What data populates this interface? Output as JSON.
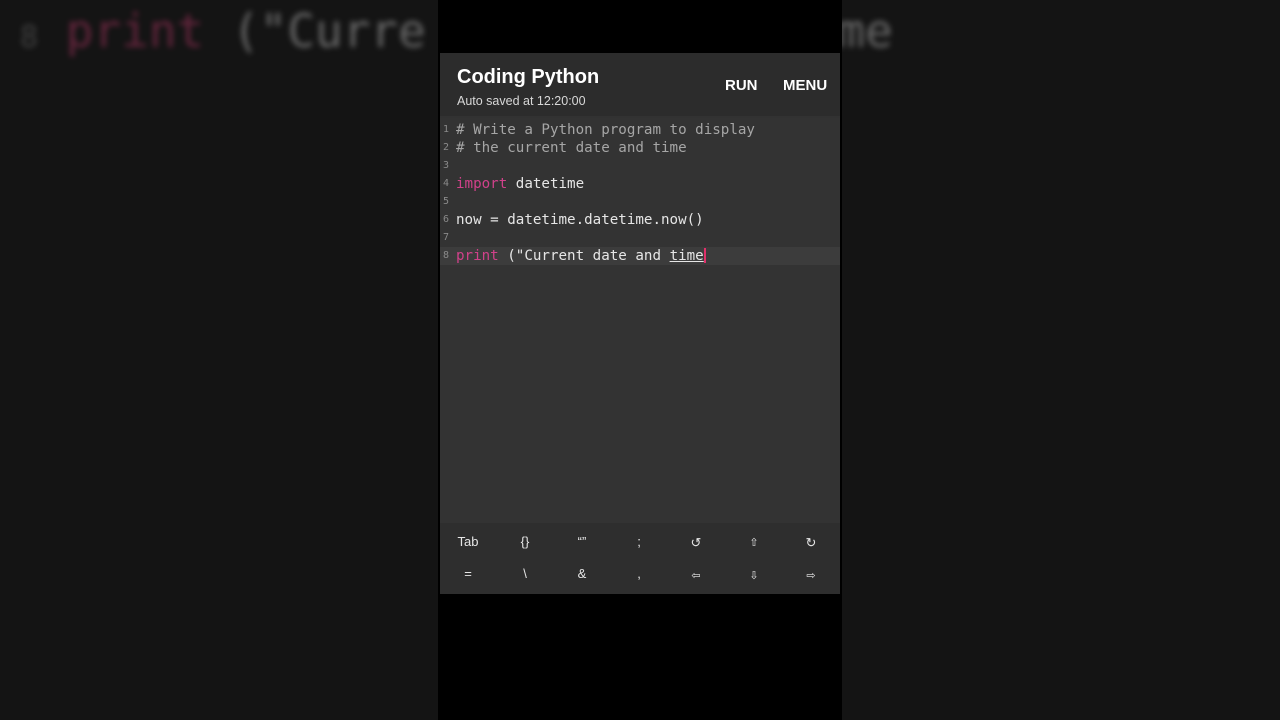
{
  "background": {
    "left_text": {
      "num": "8",
      "kw": "print",
      "str": " (\"Curre"
    },
    "right_text": "time"
  },
  "app": {
    "title": "Coding Python",
    "subtitle": "Auto saved at 12:20:00",
    "run_label": "RUN",
    "menu_label": "MENU"
  },
  "code": {
    "line_numbers": [
      "1",
      "2",
      "3",
      "4",
      "5",
      "6",
      "7",
      "8"
    ],
    "l1": "# Write a Python program to display",
    "l2": "# the current date and time",
    "l4_kw": "import",
    "l4_rest": " datetime",
    "l6": "now = datetime.datetime.now()",
    "l8_kw": "print",
    "l8_rest": " (\"Current date and ",
    "l8_word": "time"
  },
  "keyboard": {
    "row1": [
      "Tab",
      "{}",
      "“”",
      ";",
      "↺",
      "⇧",
      "↻"
    ],
    "row2": [
      "=",
      "\\",
      "&",
      ",",
      "⇦",
      "⇩",
      "⇨"
    ]
  },
  "colors": {
    "keyword": "#d0418a",
    "cursor": "#e0306a",
    "comment": "#a6a6a6"
  }
}
